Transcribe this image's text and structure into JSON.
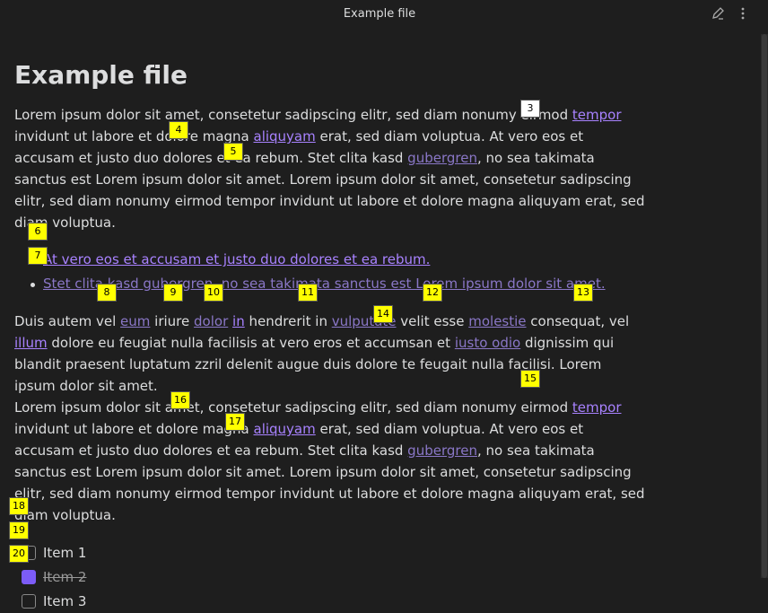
{
  "topbar": {
    "title": "Example file"
  },
  "heading": "Example file",
  "para1": {
    "t1": "Lorem ipsum dolor sit amet, consetetur sadipscing elitr, sed diam nonumy eirmod ",
    "link1": "tempor",
    "t2": " invidunt ut labore et dolore magna ",
    "link2": "aliquyam",
    "t3": " erat, sed diam voluptua. At vero eos et accusam et justo duo dolores et ea rebum. Stet clita kasd ",
    "link3": "gubergren",
    "t4": ", no sea takimata sanctus est Lorem ipsum dolor sit amet. Lorem ipsum dolor sit amet, consetetur sadipscing elitr, sed diam nonumy eirmod tempor invidunt ut labore et dolore magna aliquyam erat, sed diam voluptua."
  },
  "bullets": [
    "At vero eos et accusam et justo duo dolores et ea rebum.",
    "Stet clita kasd gubergren, no sea takimata sanctus est Lorem ipsum dolor sit amet."
  ],
  "para2": {
    "t1": "Duis autem vel ",
    "l1": "eum",
    "t2": " iriure ",
    "l2": "dolor",
    "t3": " ",
    "l3": "in",
    "t4": " hendrerit in ",
    "l4": "vulputate",
    "t5": " velit esse ",
    "l5": "molestie",
    "t6": " consequat, vel ",
    "l6": "illum",
    "t7": " dolore eu feugiat nulla facilisis at vero eros et accumsan et ",
    "l7": "iusto odio",
    "t8": " dignissim qui blandit praesent luptatum zzril delenit augue duis dolore te feugait nulla facilisi. Lorem ipsum dolor sit amet."
  },
  "para3": {
    "t1": "Lorem ipsum dolor sit amet, consetetur sadipscing elitr, sed diam nonumy eirmod ",
    "link1": "tempor",
    "t2": " invidunt ut labore et dolore magna ",
    "link2": "aliquyam",
    "t3": " erat, sed diam voluptua. At vero eos et accusam et justo duo dolores et ea rebum. Stet clita kasd ",
    "link3": "gubergren",
    "t4": ", no sea takimata sanctus est Lorem ipsum dolor sit amet. Lorem ipsum dolor sit amet, consetetur sadipscing elitr, sed diam nonumy eirmod tempor invidunt ut labore et dolore magna aliquyam erat, sed diam voluptua."
  },
  "tasks": [
    {
      "label": "Item 1",
      "checked": false
    },
    {
      "label": "Item 2",
      "checked": true
    },
    {
      "label": "Item 3",
      "checked": false
    }
  ],
  "badges": [
    "3",
    "4",
    "5",
    "6",
    "7",
    "8",
    "9",
    "10",
    "11",
    "12",
    "13",
    "14",
    "15",
    "16",
    "17",
    "18",
    "19",
    "20"
  ],
  "colors": {
    "background": "#1e1e1e",
    "link": "#a882ff",
    "accent": "#7c5cf7",
    "badge": "#ffff00"
  }
}
